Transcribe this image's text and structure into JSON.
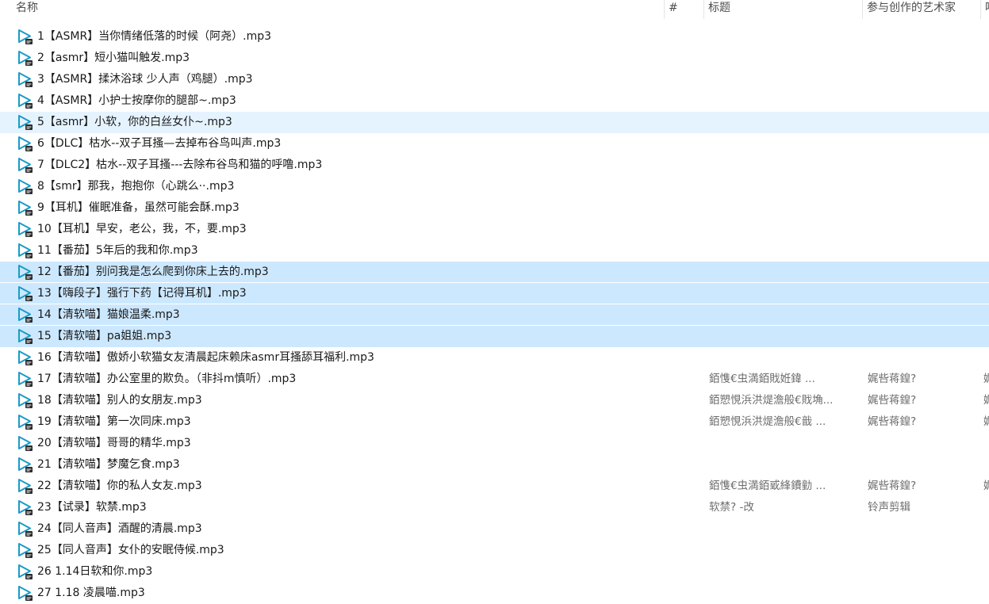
{
  "columns": {
    "name": "名称",
    "number": "#",
    "title": "标题",
    "artists": "参与创作的艺术家",
    "extra": "唱"
  },
  "files": [
    {
      "name": "1【ASMR】当你情绪低落的时候（阿尧）.mp3",
      "title": "",
      "artist": "",
      "extra": "",
      "state": ""
    },
    {
      "name": "2【asmr】短小猫叫触发.mp3",
      "title": "",
      "artist": "",
      "extra": "",
      "state": ""
    },
    {
      "name": "3【ASMR】揉沐浴球 少人声（鸡腿）.mp3",
      "title": "",
      "artist": "",
      "extra": "",
      "state": ""
    },
    {
      "name": "4【ASMR】小护士按摩你的腿部~.mp3",
      "title": "",
      "artist": "",
      "extra": "",
      "state": ""
    },
    {
      "name": "5【asmr】小软，你的白丝女仆~.mp3",
      "title": "",
      "artist": "",
      "extra": "",
      "state": "hover"
    },
    {
      "name": "6【DLC】枯水--双子耳搔—去掉布谷鸟叫声.mp3",
      "title": "",
      "artist": "",
      "extra": "",
      "state": ""
    },
    {
      "name": "7【DLC2】枯水--双子耳搔---去除布谷鸟和猫的呼噜.mp3",
      "title": "",
      "artist": "",
      "extra": "",
      "state": ""
    },
    {
      "name": "8【smr】那我，抱抱你（心跳么··.mp3",
      "title": "",
      "artist": "",
      "extra": "",
      "state": ""
    },
    {
      "name": "9【耳机】催眠准备，虽然可能会酥.mp3",
      "title": "",
      "artist": "",
      "extra": "",
      "state": ""
    },
    {
      "name": "10【耳机】早安，老公，我，不，要.mp3",
      "title": "",
      "artist": "",
      "extra": "",
      "state": ""
    },
    {
      "name": "11【番茄】5年后的我和你.mp3",
      "title": "",
      "artist": "",
      "extra": "",
      "state": ""
    },
    {
      "name": "12【番茄】别问我是怎么爬到你床上去的.mp3",
      "title": "",
      "artist": "",
      "extra": "",
      "state": "selected"
    },
    {
      "name": "13【嗨段子】强行下药【记得耳机】.mp3",
      "title": "",
      "artist": "",
      "extra": "",
      "state": "selected"
    },
    {
      "name": "14【清软喵】猫娘温柔.mp3",
      "title": "",
      "artist": "",
      "extra": "",
      "state": "selected"
    },
    {
      "name": "15【清软喵】pa姐姐.mp3",
      "title": "",
      "artist": "",
      "extra": "",
      "state": "selected"
    },
    {
      "name": "16【清软喵】傲娇小软猫女友清晨起床赖床asmr耳搔舔耳福利.mp3",
      "title": "",
      "artist": "",
      "extra": "",
      "state": ""
    },
    {
      "name": "17【清软喵】办公室里的欺负。（非抖m慎听）.mp3",
      "title": "銆愯€虫満銆戝姙鍏    ...",
      "artist": "娓呰蒋鍠?",
      "extra": "娓",
      "state": ""
    },
    {
      "name": "18【清软喵】别人的女朋友.mp3",
      "title": "銆愬悓浜洪煶澹般€戝埆...",
      "artist": "娓呰蒋鍠?",
      "extra": "娓",
      "state": ""
    },
    {
      "name": "19【清软喵】第一次同床.mp3",
      "title": "銆愬悓浜洪煶澹般€戠    ...",
      "artist": "娓呰蒋鍠?",
      "extra": "娓",
      "state": ""
    },
    {
      "name": "20【清软喵】哥哥的精华.mp3",
      "title": "",
      "artist": "",
      "extra": "",
      "state": ""
    },
    {
      "name": "21【清软喵】梦魔乞食.mp3",
      "title": "",
      "artist": "",
      "extra": "",
      "state": ""
    },
    {
      "name": "22【清软喵】你的私人女友.mp3",
      "title": "銆愯€虫満銆戜綘鐨勭    ...",
      "artist": "娓呰蒋鍠?",
      "extra": "娓",
      "state": ""
    },
    {
      "name": "23【试录】软禁.mp3",
      "title": "软禁?  -改",
      "artist": "铃声剪辑",
      "extra": "",
      "state": ""
    },
    {
      "name": "24【同人音声】酒醒的清晨.mp3",
      "title": "",
      "artist": "",
      "extra": "",
      "state": ""
    },
    {
      "name": "25【同人音声】女仆的安眠侍候.mp3",
      "title": "",
      "artist": "",
      "extra": "",
      "state": ""
    },
    {
      "name": "26  1.14日软和你.mp3",
      "title": "",
      "artist": "",
      "extra": "",
      "state": ""
    },
    {
      "name": "27  1.18 凌晨喵.mp3",
      "title": "",
      "artist": "",
      "extra": "",
      "state": ""
    }
  ],
  "icon": "mp3-media-file-icon",
  "colors": {
    "hover": "#e5f3ff",
    "selected": "#cce8ff",
    "icon_play": "#1a9bc7",
    "icon_badge": "#2b2b2b"
  }
}
